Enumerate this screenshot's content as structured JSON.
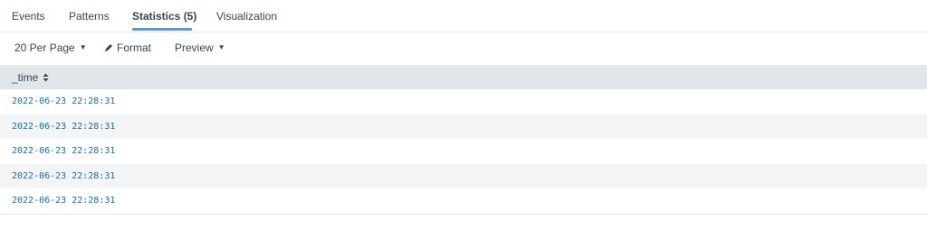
{
  "tabs": [
    {
      "label": "Events"
    },
    {
      "label": "Patterns"
    },
    {
      "label": "Statistics (5)"
    },
    {
      "label": "Visualization"
    }
  ],
  "active_tab": "Statistics (5)",
  "toolbar": {
    "per_page_label": "20 Per Page",
    "format_label": "Format",
    "preview_label": "Preview"
  },
  "table": {
    "columns": [
      "_time"
    ],
    "rows": [
      [
        "2022-06-23 22:28:31"
      ],
      [
        "2022-06-23 22:28:31"
      ],
      [
        "2022-06-23 22:28:31"
      ],
      [
        "2022-06-23 22:28:31"
      ],
      [
        "2022-06-23 22:28:31"
      ]
    ]
  },
  "colors": {
    "accent": "#5a9bd5",
    "link": "#1a6bb0",
    "header_bg": "#e1e6eb",
    "stripe_bg": "#f2f4f5"
  },
  "icons": {
    "caret": "caret-down-icon",
    "format": "pencil-icon",
    "sort": "sort-icon"
  }
}
